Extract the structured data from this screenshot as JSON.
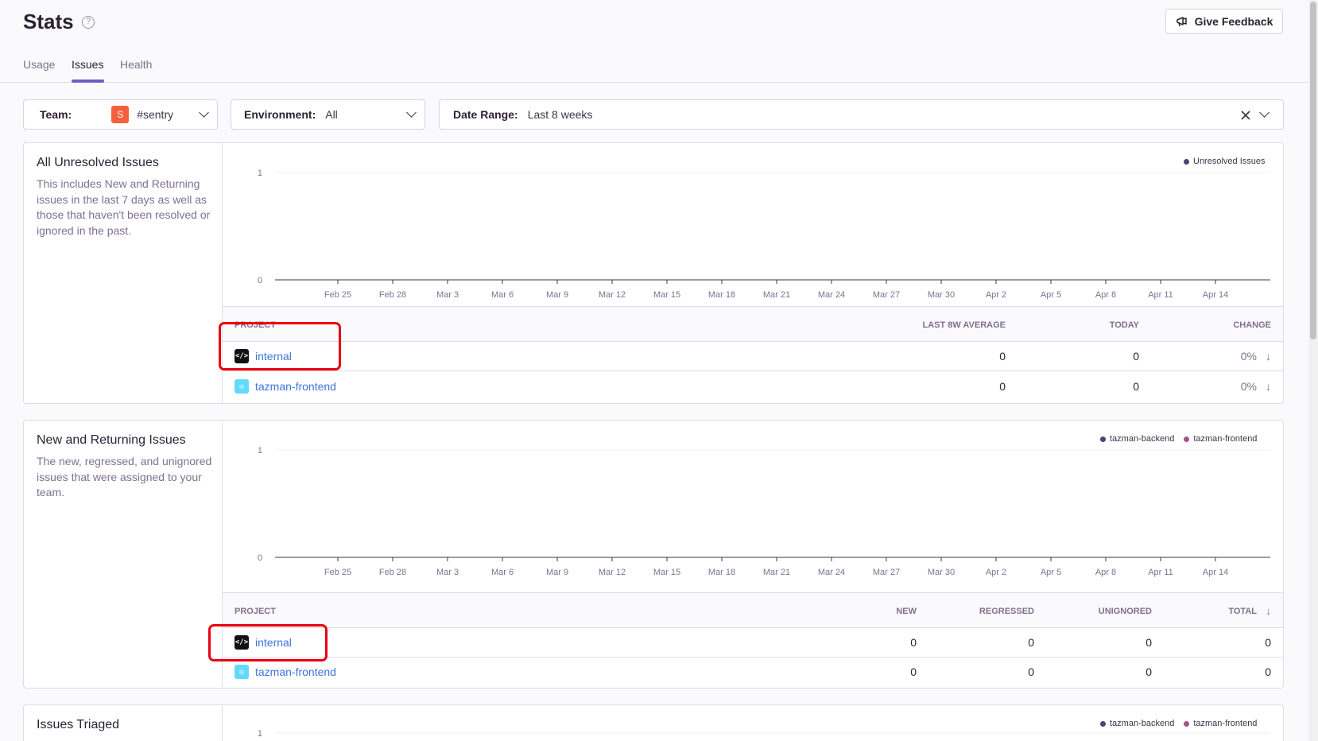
{
  "header": {
    "title": "Stats",
    "help_icon": "?",
    "feedback_label": "Give Feedback",
    "tabs": [
      {
        "label": "Usage"
      },
      {
        "label": "Issues"
      },
      {
        "label": "Health"
      }
    ]
  },
  "filters": {
    "team_label": "Team:",
    "team_avatar": "S",
    "team_value": "#sentry",
    "env_label": "Environment:",
    "env_value": "All",
    "date_label": "Date Range:",
    "date_value": "Last 8 weeks"
  },
  "x_ticks": [
    "Feb 25",
    "Feb 28",
    "Mar 3",
    "Mar 6",
    "Mar 9",
    "Mar 12",
    "Mar 15",
    "Mar 18",
    "Mar 21",
    "Mar 24",
    "Mar 27",
    "Mar 30",
    "Apr 2",
    "Apr 5",
    "Apr 8",
    "Apr 11",
    "Apr 14"
  ],
  "colors": {
    "accent": "#6c5fc7",
    "link": "#3d74db",
    "series_backend": "#444674",
    "series_frontend": "#a35488",
    "highlight": "#e8000f"
  },
  "panel1": {
    "title": "All Unresolved Issues",
    "desc": "This includes New and Returning issues in the last 7 days as well as those that haven't been resolved or ignored in the past.",
    "legend": [
      "Unresolved Issues"
    ],
    "y_top": "1",
    "y_bottom": "0",
    "columns": {
      "project": "PROJECT",
      "avg": "LAST 8W AVERAGE",
      "today": "TODAY",
      "change": "CHANGE"
    },
    "rows": [
      {
        "project": "internal",
        "icon": "code-icon",
        "avg": "0",
        "today": "0",
        "change": "0%"
      },
      {
        "project": "tazman-frontend",
        "icon": "react-icon",
        "avg": "0",
        "today": "0",
        "change": "0%"
      }
    ]
  },
  "panel2": {
    "title": "New and Returning Issues",
    "desc": "The new, regressed, and unignored issues that were assigned to your team.",
    "legend": [
      "tazman-backend",
      "tazman-frontend"
    ],
    "y_top": "1",
    "y_bottom": "0",
    "columns": {
      "project": "PROJECT",
      "new": "NEW",
      "regressed": "REGRESSED",
      "unignored": "UNIGNORED",
      "total": "TOTAL"
    },
    "rows": [
      {
        "project": "internal",
        "icon": "code-icon",
        "new": "0",
        "regressed": "0",
        "unignored": "0",
        "total": "0"
      },
      {
        "project": "tazman-frontend",
        "icon": "react-icon",
        "new": "0",
        "regressed": "0",
        "unignored": "0",
        "total": "0"
      }
    ]
  },
  "panel3": {
    "title": "Issues Triaged",
    "legend": [
      "tazman-backend",
      "tazman-frontend"
    ],
    "y_top": "1"
  }
}
